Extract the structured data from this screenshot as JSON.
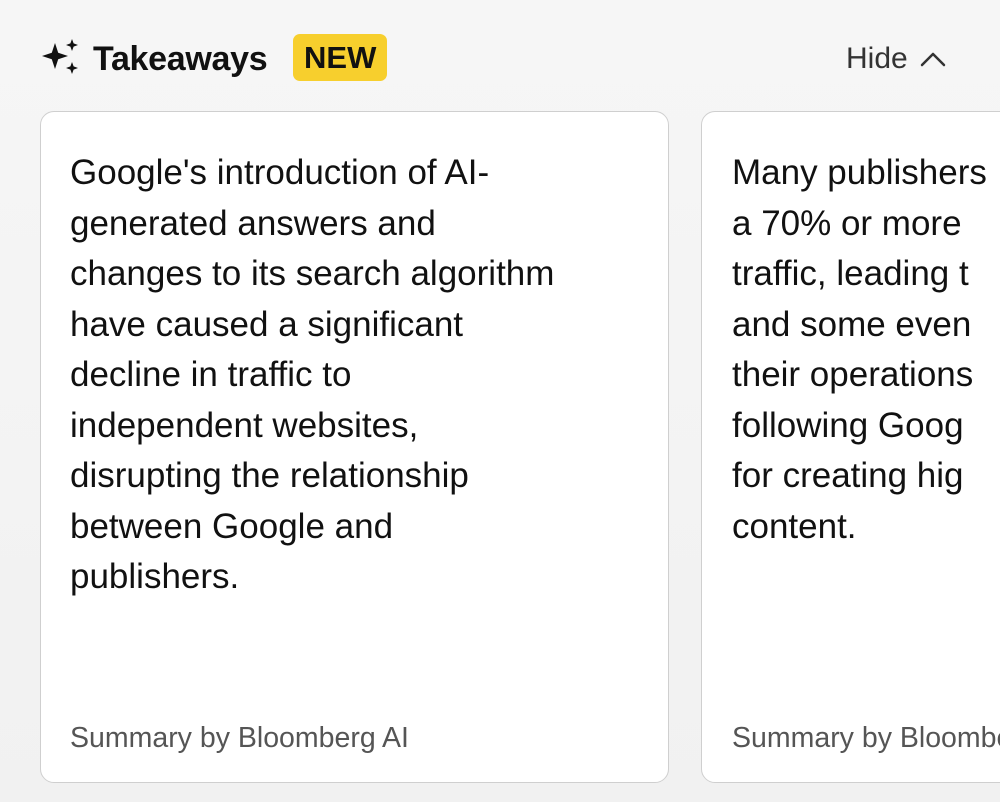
{
  "header": {
    "title": "Takeaways",
    "badge": "NEW",
    "hide_label": "Hide",
    "title_icon": "sparkle-icon",
    "toggle_icon": "chevron-up-icon"
  },
  "colors": {
    "badge_bg": "#f7cf2d",
    "card_bg": "#ffffff",
    "page_bg": "#f4f4f4",
    "footer_text": "#555555"
  },
  "cards": [
    {
      "text": "Google's introduction of AI-\ngenerated answers and\nchanges to its search algorithm\nhave caused a significant\ndecline in traffic to\nindependent websites,\ndisrupting the relationship\nbetween Google and\npublishers.",
      "footer": "Summary by Bloomberg AI"
    },
    {
      "text": "Many publishers\na 70% or more\ntraffic, leading t\nand some even\ntheir operations\nfollowing Goog\nfor creating hig\ncontent.",
      "footer": "Summary by Bloomberg AI"
    }
  ]
}
